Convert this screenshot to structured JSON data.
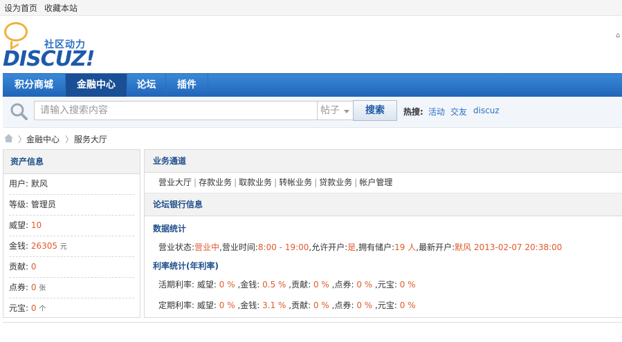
{
  "topbar": {
    "set_home": "设为首页",
    "bookmark": "收藏本站"
  },
  "logo": {
    "slogan": "社区动力",
    "wordmark": "DISCUZ!"
  },
  "nav": [
    "积分商城",
    "金融中心",
    "论坛",
    "插件"
  ],
  "search": {
    "placeholder": "请输入搜索内容",
    "type": "帖子",
    "button": "搜索",
    "hot_label": "热搜:",
    "hot": [
      "活动",
      "交友",
      "discuz"
    ]
  },
  "breadcrumb": {
    "items": [
      "金融中心",
      "服务大厅"
    ]
  },
  "assets": {
    "title": "资产信息",
    "user_label": "用户:",
    "user_value": "默风",
    "level_label": "等级:",
    "level_value": "管理员",
    "prestige_label": "威望:",
    "prestige_value": "10",
    "money_label": "金钱:",
    "money_value": "26305",
    "money_unit": "元",
    "contrib_label": "贡献:",
    "contrib_value": "0",
    "coupon_label": "点券:",
    "coupon_value": "0",
    "coupon_unit": "张",
    "ingot_label": "元宝:",
    "ingot_value": "0",
    "ingot_unit": "个"
  },
  "business": {
    "title": "业务通道",
    "links": [
      "营业大厅",
      "存款业务",
      "取款业务",
      "转帐业务",
      "贷款业务",
      "帐户管理"
    ]
  },
  "bank": {
    "title": "论坛银行信息",
    "stats_title": "数据统计",
    "status_label": "营业状态:",
    "status_value": "营业中",
    "hours_label": ",营业时间:",
    "hours_value": "8:00 - 19:00",
    "open_label": ",允许开户:",
    "open_value": "是",
    "depositors_label": ",拥有储户:",
    "depositors_value": "19 人",
    "newest_label": ",最新开户:",
    "newest_user": "默风",
    "newest_time": "2013-02-07 20:38:00",
    "rate_title": "利率统计(年利率)",
    "current": {
      "label": "活期利率:",
      "items": [
        {
          "name": "威望:",
          "value": "0 %"
        },
        {
          "name": ",金钱:",
          "value": "0.5 %"
        },
        {
          "name": ",贡献:",
          "value": "0 %"
        },
        {
          "name": ",点券:",
          "value": "0 %"
        },
        {
          "name": ",元宝:",
          "value": "0 %"
        }
      ]
    },
    "fixed": {
      "label": "定期利率:",
      "items": [
        {
          "name": "威望:",
          "value": "0 %"
        },
        {
          "name": ",金钱:",
          "value": "3.1 %"
        },
        {
          "name": ",贡献:",
          "value": "0 %"
        },
        {
          "name": ",点券:",
          "value": "0 %"
        },
        {
          "name": ",元宝:",
          "value": "0 %"
        }
      ]
    }
  },
  "colors": {
    "accent": "#1f64b8",
    "highlight": "#e05a2a",
    "link": "#2b6fc4"
  }
}
